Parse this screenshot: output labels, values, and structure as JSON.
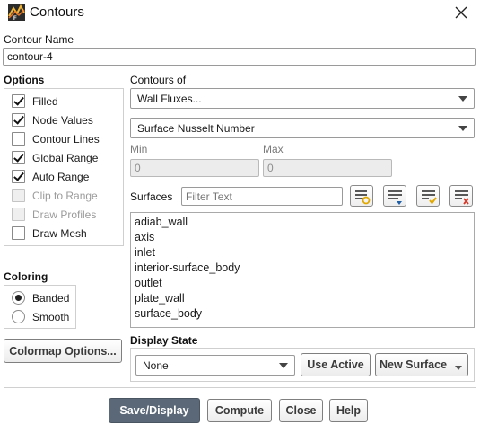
{
  "window": {
    "title": "Contours"
  },
  "contour_name": {
    "label": "Contour Name",
    "value": "contour-4"
  },
  "options": {
    "label": "Options",
    "items": [
      {
        "label": "Filled",
        "checked": true,
        "enabled": true
      },
      {
        "label": "Node Values",
        "checked": true,
        "enabled": true
      },
      {
        "label": "Contour Lines",
        "checked": false,
        "enabled": true
      },
      {
        "label": "Global Range",
        "checked": true,
        "enabled": true
      },
      {
        "label": "Auto Range",
        "checked": true,
        "enabled": true
      },
      {
        "label": "Clip to Range",
        "checked": false,
        "enabled": false
      },
      {
        "label": "Draw Profiles",
        "checked": false,
        "enabled": false
      },
      {
        "label": "Draw Mesh",
        "checked": false,
        "enabled": true
      }
    ]
  },
  "contours_of": {
    "label": "Contours of",
    "category": "Wall Fluxes...",
    "field": "Surface Nusselt Number"
  },
  "range": {
    "min_label": "Min",
    "min_value": "0",
    "max_label": "Max",
    "max_value": "0"
  },
  "surfaces": {
    "label": "Surfaces",
    "filter_placeholder": "Filter Text",
    "items": [
      "adiab_wall",
      "axis",
      "inlet",
      "interior-surface_body",
      "outlet",
      "plate_wall",
      "surface_body"
    ]
  },
  "coloring": {
    "label": "Coloring",
    "options": [
      {
        "label": "Banded",
        "selected": true
      },
      {
        "label": "Smooth",
        "selected": false
      }
    ]
  },
  "colormap_button": "Colormap Options...",
  "display_state": {
    "label": "Display State",
    "value": "None",
    "use_active": "Use Active",
    "new_surface": "New Surface"
  },
  "footer": {
    "save_display": "Save/Display",
    "compute": "Compute",
    "close": "Close",
    "help": "Help"
  },
  "colors": {
    "primary_button": "#5a6878",
    "icon_blue": "#1f5fa8",
    "icon_yellow": "#e0a800",
    "icon_red": "#d43a2a"
  }
}
